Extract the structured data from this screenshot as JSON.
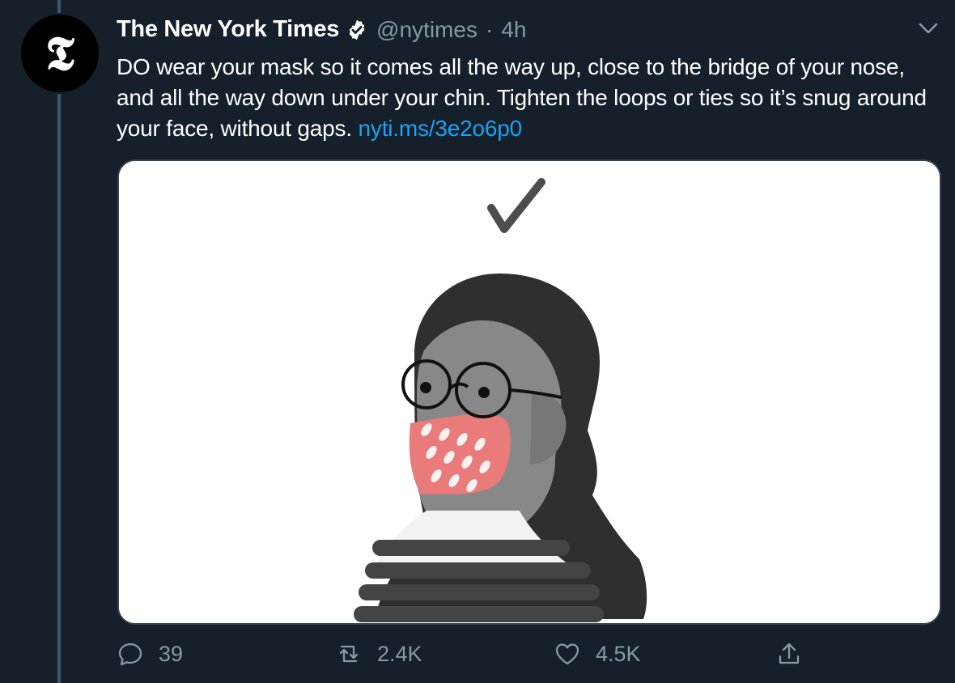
{
  "profile": {
    "avatar_label": "𝕿",
    "display_name": "The New York Times",
    "handle": "@nytimes",
    "separator": "·",
    "time": "4h"
  },
  "tweet": {
    "text": "DO wear your mask so it comes all the way up, close to the bridge of your nose, and all the way down under your chin. Tighten the loops or ties so it’s snug around your face, without gaps.",
    "link": "nyti.ms/3e2o6p0"
  },
  "actions": {
    "reply_count": "39",
    "retweet_count": "2.4K",
    "like_count": "4.5K"
  },
  "icons": {
    "avatar": "nyt-logo-icon",
    "verified": "verified-badge-icon",
    "menu": "chevron-down-icon",
    "reply": "reply-icon",
    "retweet": "retweet-icon",
    "like": "heart-icon",
    "share": "share-icon"
  },
  "colors": {
    "background": "#15202b",
    "text": "#ffffff",
    "muted": "#8899a6",
    "link": "#1da1f2",
    "border": "#38444d",
    "mask": "#e97b7b"
  }
}
